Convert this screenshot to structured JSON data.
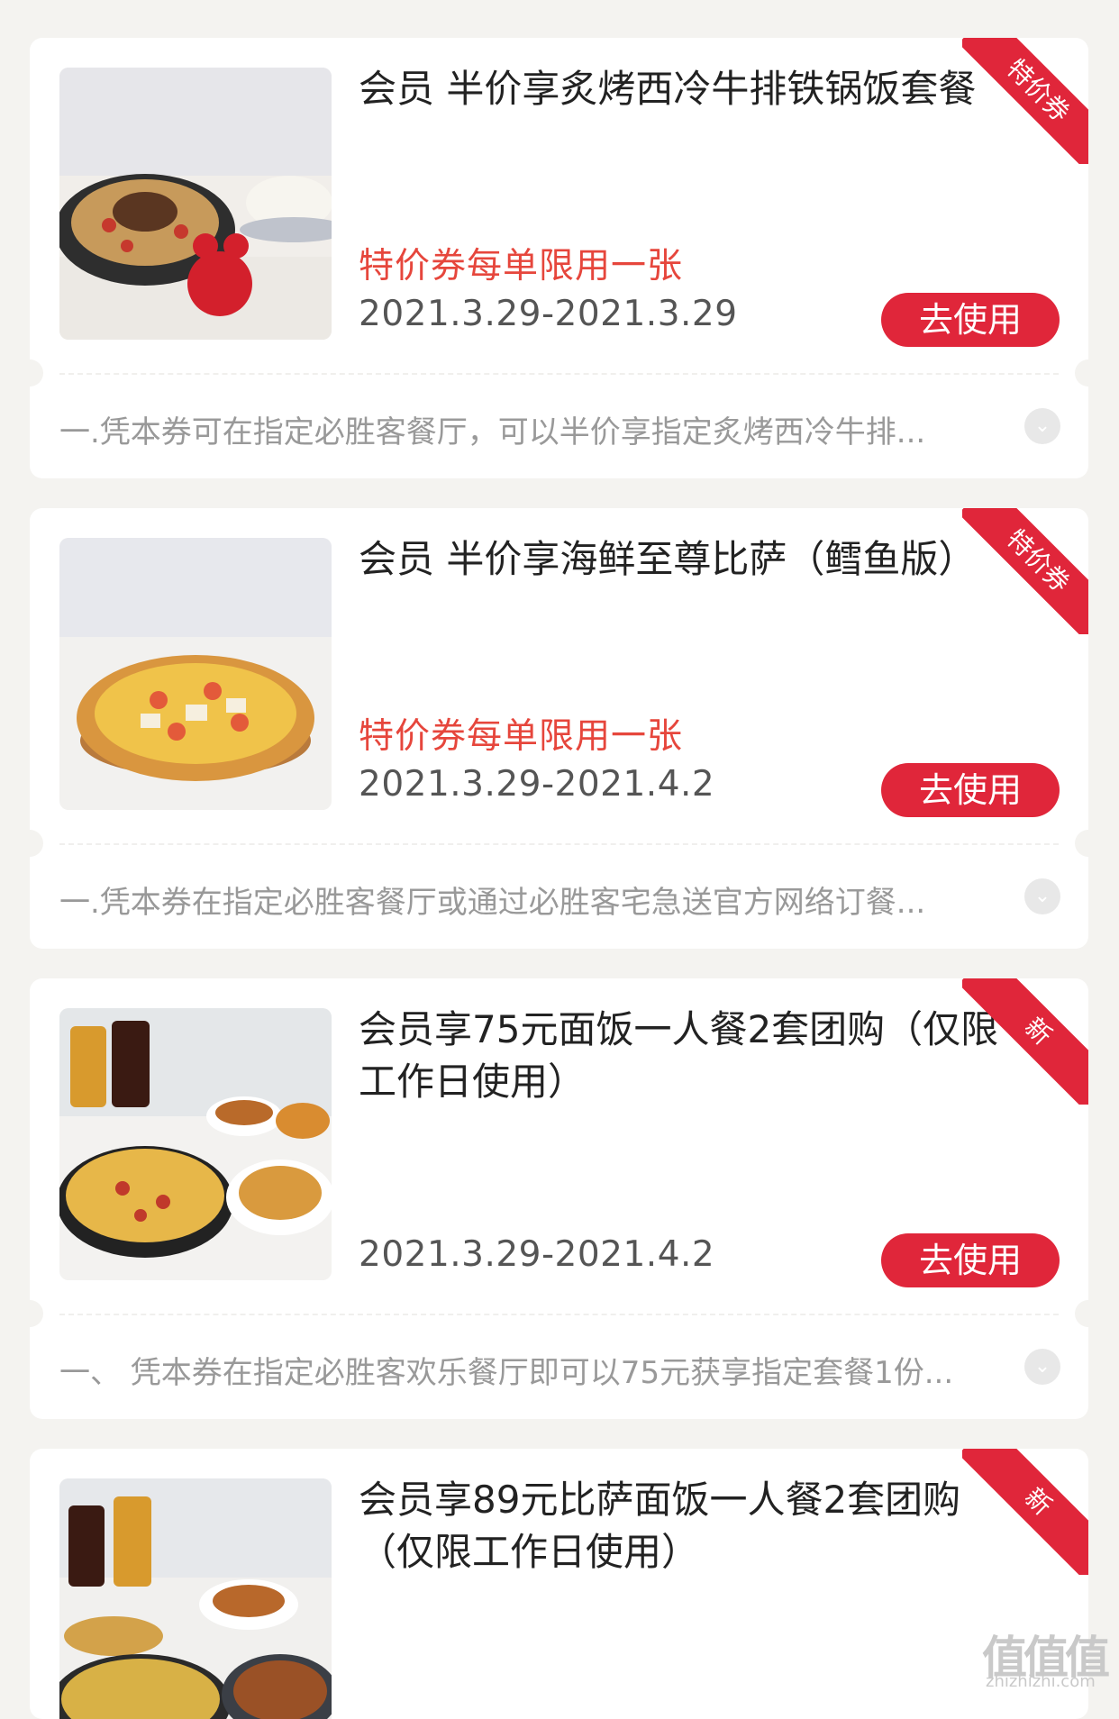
{
  "coupons": [
    {
      "title": "会员 半价享炙烤西冷牛排铁锅饭套餐",
      "limit": "特价券每单限用一张",
      "date": "2021.3.29-2021.3.29",
      "button": "去使用",
      "tag": "特价券",
      "description": "一.凭本券可在指定必胜客餐厅，可以半价享指定炙烤西冷牛排...",
      "image": "steak-rice-skillet"
    },
    {
      "title": "会员 半价享海鲜至尊比萨（鳕鱼版）",
      "limit": "特价券每单限用一张",
      "date": "2021.3.29-2021.4.2",
      "button": "去使用",
      "tag": "特价券",
      "description": "一.凭本券在指定必胜客餐厅或通过必胜客宅急送官方网络订餐...",
      "image": "seafood-pizza"
    },
    {
      "title": "会员享75元面饭一人餐2套团购（仅限工作日使用）",
      "limit": "",
      "date": "2021.3.29-2021.4.2",
      "button": "去使用",
      "tag": "新",
      "description": "一、 凭本券在指定必胜客欢乐餐厅即可以75元获享指定套餐1份...",
      "image": "combo-meal"
    },
    {
      "title": "会员享89元比萨面饭一人餐2套团购（仅限工作日使用）",
      "limit": "",
      "date": "",
      "button": "",
      "tag": "新",
      "description": "",
      "image": "pizza-combo"
    }
  ],
  "watermark": {
    "logo": "值值值",
    "url": "zhizhizhi.com"
  },
  "colors": {
    "accent": "#e0263a",
    "limit_text": "#e6463c",
    "background": "#f4f3f0"
  }
}
